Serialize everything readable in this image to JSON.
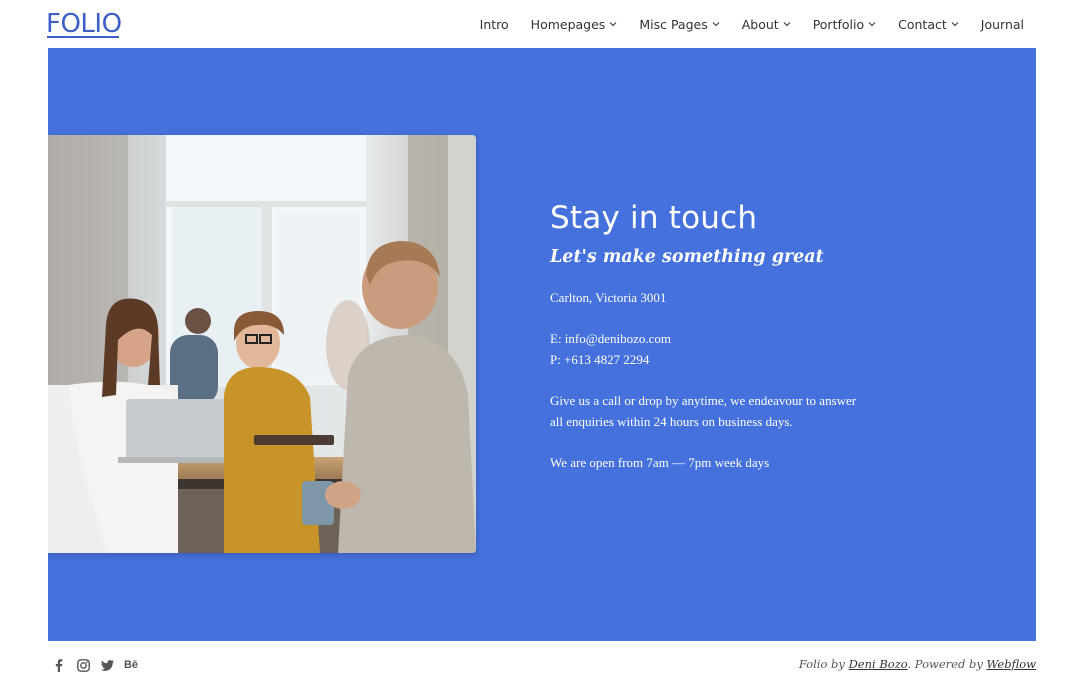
{
  "brand": {
    "logo_text": "FOLIO",
    "accent": "#3b5fc6",
    "hero_bg": "#4571dd"
  },
  "nav": {
    "items": [
      {
        "label": "Intro",
        "has_dropdown": false
      },
      {
        "label": "Homepages",
        "has_dropdown": true
      },
      {
        "label": "Misc Pages",
        "has_dropdown": true
      },
      {
        "label": "About",
        "has_dropdown": true
      },
      {
        "label": "Portfolio",
        "has_dropdown": true
      },
      {
        "label": "Contact",
        "has_dropdown": true
      },
      {
        "label": "Journal",
        "has_dropdown": false
      }
    ]
  },
  "contact": {
    "title": "Stay in touch",
    "subtitle": "Let's make something great",
    "address": "Carlton, Victoria 3001",
    "email": "E: info@denibozo.com",
    "phone": "P: +613 4827 2294",
    "message_line1": "Give us a call or drop by anytime, we endeavour to answer",
    "message_line2": "all enquiries within 24 hours on business days.",
    "hours": "We are open from 7am — 7pm week days"
  },
  "footer": {
    "social_icons": [
      "facebook-icon",
      "instagram-icon",
      "twitter-icon",
      "behance-icon"
    ],
    "behance_text": "Bē",
    "credit_prefix": "Folio by ",
    "credit_author": "Deni Bozo",
    "credit_middle": ". Powered by ",
    "credit_platform": "Webflow"
  }
}
